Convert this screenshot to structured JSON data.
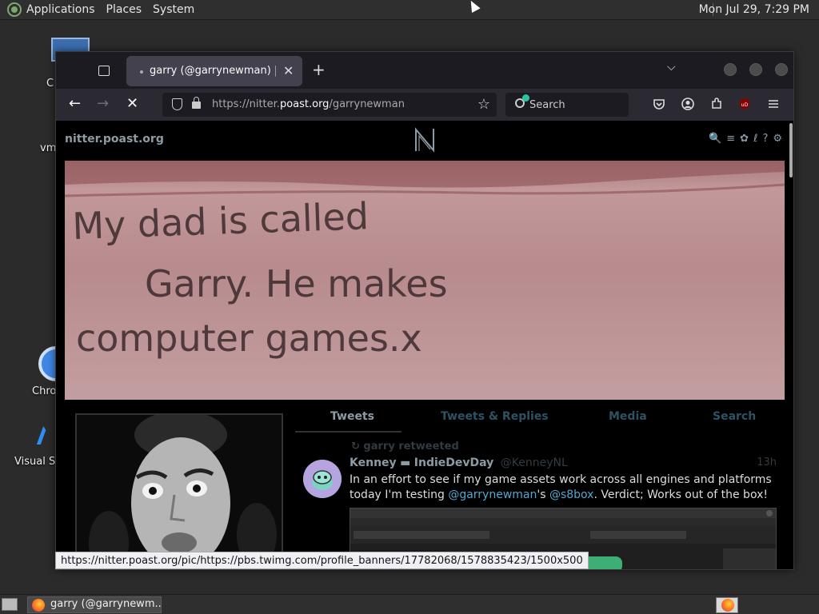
{
  "top_panel": {
    "menus": [
      "Applications",
      "Places",
      "System"
    ],
    "clock": "Mon Jul 29,  7:29 PM"
  },
  "desktop": {
    "icons": [
      {
        "label": "C",
        "icon": "computer-icon"
      },
      {
        "label": "vm",
        "icon": "vm-icon"
      },
      {
        "label": "Chro",
        "icon": "chrome-icon"
      },
      {
        "label": "Visual St",
        "icon": "vscode-icon"
      }
    ]
  },
  "browser": {
    "tab_title": "garry (@garrynewman) | nitter",
    "tab_close": "✕",
    "new_tab": "+",
    "tab_dropdown": "⌄",
    "url_prefix": "https://nitter.",
    "url_host": "poast.org",
    "url_path": "/garrynewman",
    "search_placeholder": "Search",
    "star": "☆"
  },
  "site": {
    "name": "nitter.poast.org",
    "banner_text": [
      "My dad is called",
      "Garry. He makes",
      "computer games.x"
    ],
    "tabs": [
      "Tweets",
      "Tweets & Replies",
      "Media",
      "Search"
    ],
    "active_tab": "Tweets"
  },
  "tweet": {
    "retweet_line": "garry retweeted",
    "author_name": "Kenney",
    "author_name_2": "IndieDevDay",
    "handle": "@KenneyNL",
    "time": "13h",
    "body_1": "In an effort to see if my game assets work across all engines and platforms today I'm testing ",
    "mention_1": "@garrynewman",
    "body_2": "'s ",
    "mention_2": "@s8box",
    "body_3": ". Verdict; Works out of the box!"
  },
  "status_url": "https://nitter.poast.org/pic/https://pbs.twimg.com/profile_banners/17782068/1578835423/1500x500",
  "taskbar": {
    "task_title": "garry (@garrynewm..."
  },
  "colors": {
    "banner": "#b88b8e",
    "link": "#53a7d2",
    "nitter_muted": "#8d9ba5"
  }
}
